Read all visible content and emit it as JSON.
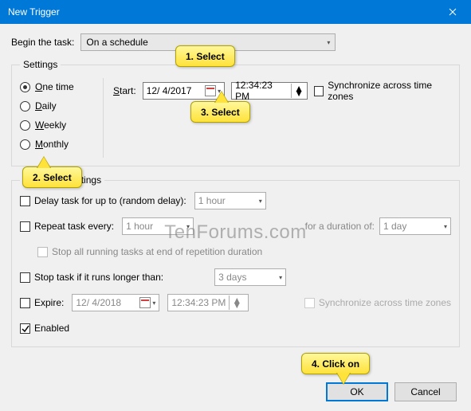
{
  "title": "New Trigger",
  "begin": {
    "label": "Begin the task:",
    "value": "On a schedule"
  },
  "settings": {
    "legend": "Settings",
    "freq": [
      {
        "label": "One time",
        "ul": "O",
        "rest": "ne time",
        "checked": true
      },
      {
        "label": "Daily",
        "ul": "D",
        "rest": "aily",
        "checked": false
      },
      {
        "label": "Weekly",
        "ul": "W",
        "rest": "eekly",
        "checked": false
      },
      {
        "label": "Monthly",
        "ul": "M",
        "rest": "onthly",
        "checked": false
      }
    ],
    "start_label_ul": "S",
    "start_label_rest": "tart:",
    "date": "12/ 4/2017",
    "time": "12:34:23 PM",
    "sync_label": "Synchronize across time zones"
  },
  "advanced": {
    "legend": "Advanced settings",
    "delay_label": "Delay task for up to (random delay):",
    "delay_value": "1 hour",
    "repeat_label": "Repeat task every:",
    "repeat_value": "1 hour",
    "duration_label": "for a duration of:",
    "duration_value": "1 day",
    "stop_rep_label": "Stop all running tasks at end of repetition duration",
    "stop_if_label": "Stop task if it runs longer than:",
    "stop_if_value": "3 days",
    "expire_label": "Expire:",
    "expire_date": "12/ 4/2018",
    "expire_time": "12:34:23 PM",
    "sync_label": "Synchronize across time zones",
    "enabled_label": "Enabled"
  },
  "buttons": {
    "ok": "OK",
    "cancel": "Cancel"
  },
  "callouts": {
    "c1": "1. Select",
    "c2": "2. Select",
    "c3": "3. Select",
    "c4": "4. Click on"
  },
  "watermark": "TenForums.com"
}
